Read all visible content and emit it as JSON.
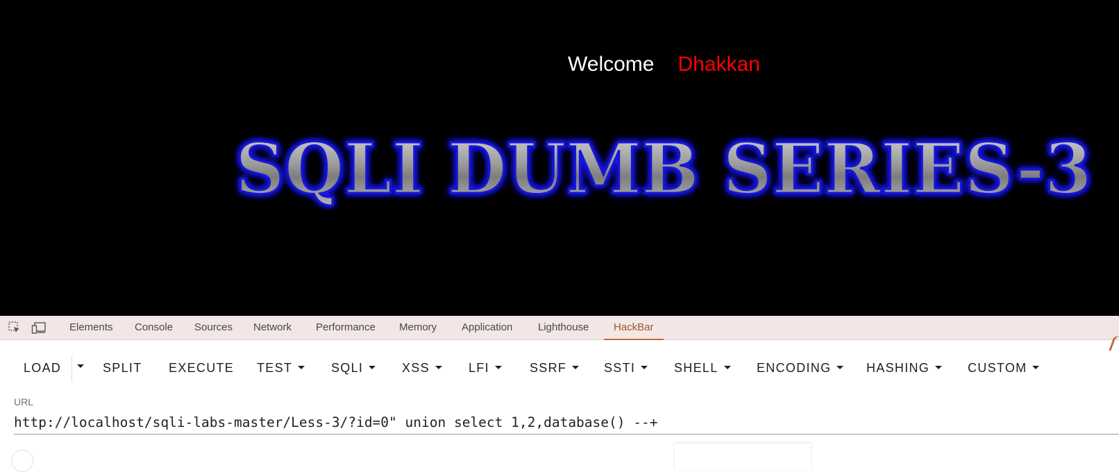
{
  "page": {
    "welcome_label": "Welcome",
    "user_name": "Dhakkan",
    "banner_text": "SQLI DUMB SERIES-3",
    "colors": {
      "background": "#000000",
      "welcome": "#ffffff",
      "user_name": "#ff0000",
      "banner_glow": "#1a1aff"
    }
  },
  "devtools": {
    "icons": [
      "inspect-element-icon",
      "device-toolbar-icon"
    ],
    "tabs": [
      "Elements",
      "Console",
      "Sources",
      "Network",
      "Performance",
      "Memory",
      "Application",
      "Lighthouse",
      "HackBar"
    ],
    "active_tab": "HackBar"
  },
  "hackbar": {
    "buttons": [
      "LOAD",
      "SPLIT",
      "EXECUTE",
      "TEST",
      "SQLI",
      "XSS",
      "LFI",
      "SSRF",
      "SSTI",
      "SHELL",
      "ENCODING",
      "HASHING",
      "CUSTOM"
    ],
    "dropdown_buttons": [
      "TEST",
      "SQLI",
      "XSS",
      "LFI",
      "SSRF",
      "SSTI",
      "SHELL",
      "ENCODING",
      "HASHING",
      "CUSTOM"
    ],
    "url_label": "URL",
    "url_value": "http://localhost/sqli-labs-master/Less-3/?id=0\" union select 1,2,database() --+"
  }
}
